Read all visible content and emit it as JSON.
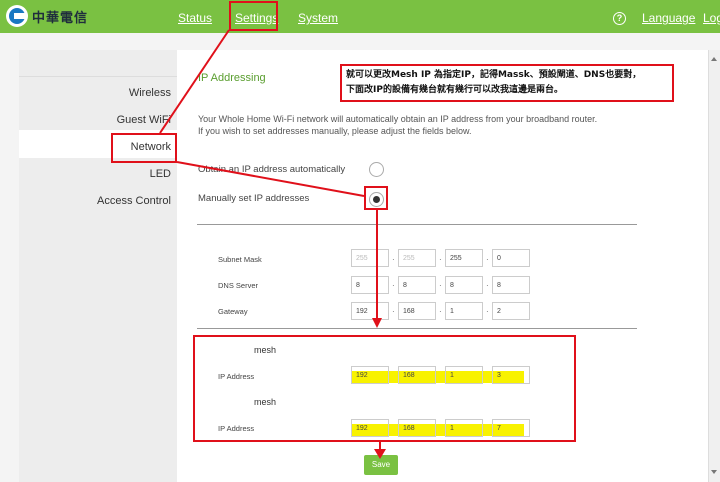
{
  "brand": {
    "name": "中華電信"
  },
  "topnav": {
    "status": "Status",
    "settings": "Settings",
    "system": "System",
    "help": "?",
    "language": "Language",
    "logout": "Log"
  },
  "sidebar": {
    "items": [
      "Wireless",
      "Guest WiFi",
      "Network",
      "LED",
      "Access Control"
    ]
  },
  "page": {
    "title": "IP Addressing",
    "desc1": "Your Whole Home Wi-Fi network will automatically obtain an IP address from your broadband router.",
    "desc2": "If you wish to set addresses manually, please adjust the fields below.",
    "opt_auto": "Obtain an IP address automatically",
    "opt_manual": "Manually set IP addresses",
    "subnet_label": "Subnet Mask",
    "subnet": [
      "255",
      "255",
      "255",
      "0"
    ],
    "dns_label": "DNS Server",
    "dns": [
      "8",
      "8",
      "8",
      "8"
    ],
    "gateway_label": "Gateway",
    "gateway": [
      "192",
      "168",
      "1",
      "2"
    ],
    "mesh_label": "mesh",
    "ip_label": "IP Address",
    "mesh1": [
      "192",
      "168",
      "1",
      "3"
    ],
    "mesh2": [
      "192",
      "168",
      "1",
      "7"
    ],
    "save": "Save"
  },
  "annotation": {
    "line1": "就可以更改Mesh IP 為指定IP，記得Massk、預設閘道、DNS也要對，",
    "line2": "下面改IP的設備有幾台就有幾行可以改我這邊是兩台。"
  },
  "colors": {
    "brand_green": "#7ac142",
    "annotation_red": "#e0101a",
    "highlight": "#f8f200"
  }
}
